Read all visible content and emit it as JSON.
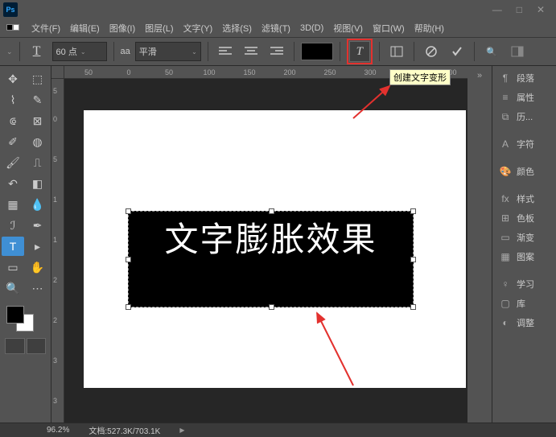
{
  "app": {
    "logo": "Ps"
  },
  "window_controls": {
    "min": "—",
    "max": "□",
    "close": "✕"
  },
  "menu": [
    "文件(F)",
    "编辑(E)",
    "图像(I)",
    "图层(L)",
    "文字(Y)",
    "选择(S)",
    "滤镜(T)",
    "3D(D)",
    "视图(V)",
    "窗口(W)",
    "帮助(H)"
  ],
  "options": {
    "tool_icon": "T",
    "font_size": "60 点",
    "aa_label": "aa",
    "aa_method": "平滑",
    "warp_tooltip": "创建文字变形"
  },
  "ruler_h": [
    {
      "pos": 30,
      "label": "50"
    },
    {
      "pos": 80,
      "label": "0"
    },
    {
      "pos": 130,
      "label": "50"
    },
    {
      "pos": 180,
      "label": "100"
    },
    {
      "pos": 230,
      "label": "150"
    },
    {
      "pos": 280,
      "label": "200"
    },
    {
      "pos": 330,
      "label": "250"
    },
    {
      "pos": 380,
      "label": "300"
    },
    {
      "pos": 430,
      "label": "350"
    },
    {
      "pos": 480,
      "label": "400"
    }
  ],
  "ruler_v": [
    {
      "pos": 15,
      "label": "5"
    },
    {
      "pos": 50,
      "label": "0"
    },
    {
      "pos": 100,
      "label": "5"
    },
    {
      "pos": 150,
      "label": "1"
    },
    {
      "pos": 200,
      "label": "1"
    },
    {
      "pos": 250,
      "label": "2"
    },
    {
      "pos": 300,
      "label": "2"
    },
    {
      "pos": 350,
      "label": "3"
    },
    {
      "pos": 400,
      "label": "3"
    }
  ],
  "canvas": {
    "text": "文字膨胀效果"
  },
  "panels": [
    {
      "icon": "¶",
      "label": "段落"
    },
    {
      "icon": "≡",
      "label": "属性"
    },
    {
      "icon": "⧉",
      "label": "历..."
    },
    {
      "gap": true
    },
    {
      "icon": "A",
      "label": "字符"
    },
    {
      "gap": true
    },
    {
      "icon": "🎨",
      "label": "颜色"
    },
    {
      "gap": true
    },
    {
      "icon": "fx",
      "label": "样式"
    },
    {
      "icon": "⊞",
      "label": "色板"
    },
    {
      "icon": "▭",
      "label": "渐变"
    },
    {
      "icon": "▦",
      "label": "图案"
    },
    {
      "gap": true
    },
    {
      "icon": "♀",
      "label": "学习"
    },
    {
      "icon": "▢",
      "label": "库"
    },
    {
      "icon": "◐",
      "label": "调整"
    }
  ],
  "status": {
    "zoom": "96.2%",
    "doc": "文档:527.3K/703.1K"
  }
}
